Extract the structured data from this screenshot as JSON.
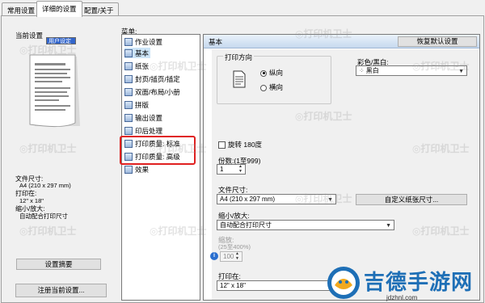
{
  "tabs": [
    {
      "label": "常用设置",
      "active": false
    },
    {
      "label": "详细的设置",
      "active": true
    },
    {
      "label": "配置/关于",
      "active": false
    }
  ],
  "left": {
    "title": "当前设置",
    "preset": "用户设定",
    "summary": {
      "paper_size_label": "文件尺寸:",
      "paper_size_value": "A4 (210 x 297 mm)",
      "print_on_label": "打印在:",
      "print_on_value": "12\" x 18\"",
      "scale_label": "缩小/放大:",
      "scale_value": "自动配合打印尺寸"
    },
    "settings_summary_button": "设置摘要",
    "register_button": "注册当前设置..."
  },
  "menu": {
    "label": "菜单:",
    "items": [
      {
        "label": "作业设置",
        "selected": false
      },
      {
        "label": "基本",
        "selected": true
      },
      {
        "label": "纸张",
        "selected": false
      },
      {
        "label": "封页/插页/插定",
        "selected": false
      },
      {
        "label": "双面/布局/小册",
        "selected": false
      },
      {
        "label": "拼版",
        "selected": false
      },
      {
        "label": "输出设置",
        "selected": false
      },
      {
        "label": "印后处理",
        "selected": false
      },
      {
        "label": "打印质量: 标准",
        "selected": false
      },
      {
        "label": "打印质量: 高级",
        "selected": false
      },
      {
        "label": "效果",
        "selected": false
      }
    ]
  },
  "panel": {
    "title": "基本",
    "restore_button": "恢复默认设置",
    "orientation": {
      "label": "打印方向",
      "options": [
        {
          "label": "纵向",
          "checked": true
        },
        {
          "label": "横向",
          "checked": false
        }
      ]
    },
    "color": {
      "label": "彩色/黑白:",
      "value": "黑白"
    },
    "rotate180": {
      "label": "旋转 180度",
      "checked": false
    },
    "copies": {
      "label": "份数:(1至999)",
      "value": "1"
    },
    "paper_size": {
      "label": "文件尺寸:",
      "value": "A4 (210 x 297 mm)"
    },
    "custom_size_button": "自定义纸张尺寸...",
    "scale": {
      "label": "缩小/放大:",
      "value": "自动配合打印尺寸"
    },
    "zoom": {
      "label": "缩放:",
      "range": "(25至400%)",
      "value": "100"
    },
    "print_on": {
      "label": "打印在:",
      "value": "12\" x 18\""
    }
  },
  "watermark_text": "打印机卫士",
  "logo": {
    "name": "吉德手游网",
    "url": "jdzhnl.com"
  },
  "colors": {
    "accent": "#1e6fb6",
    "highlight_box": "#e02020",
    "selected_row": "#cce4f7"
  }
}
